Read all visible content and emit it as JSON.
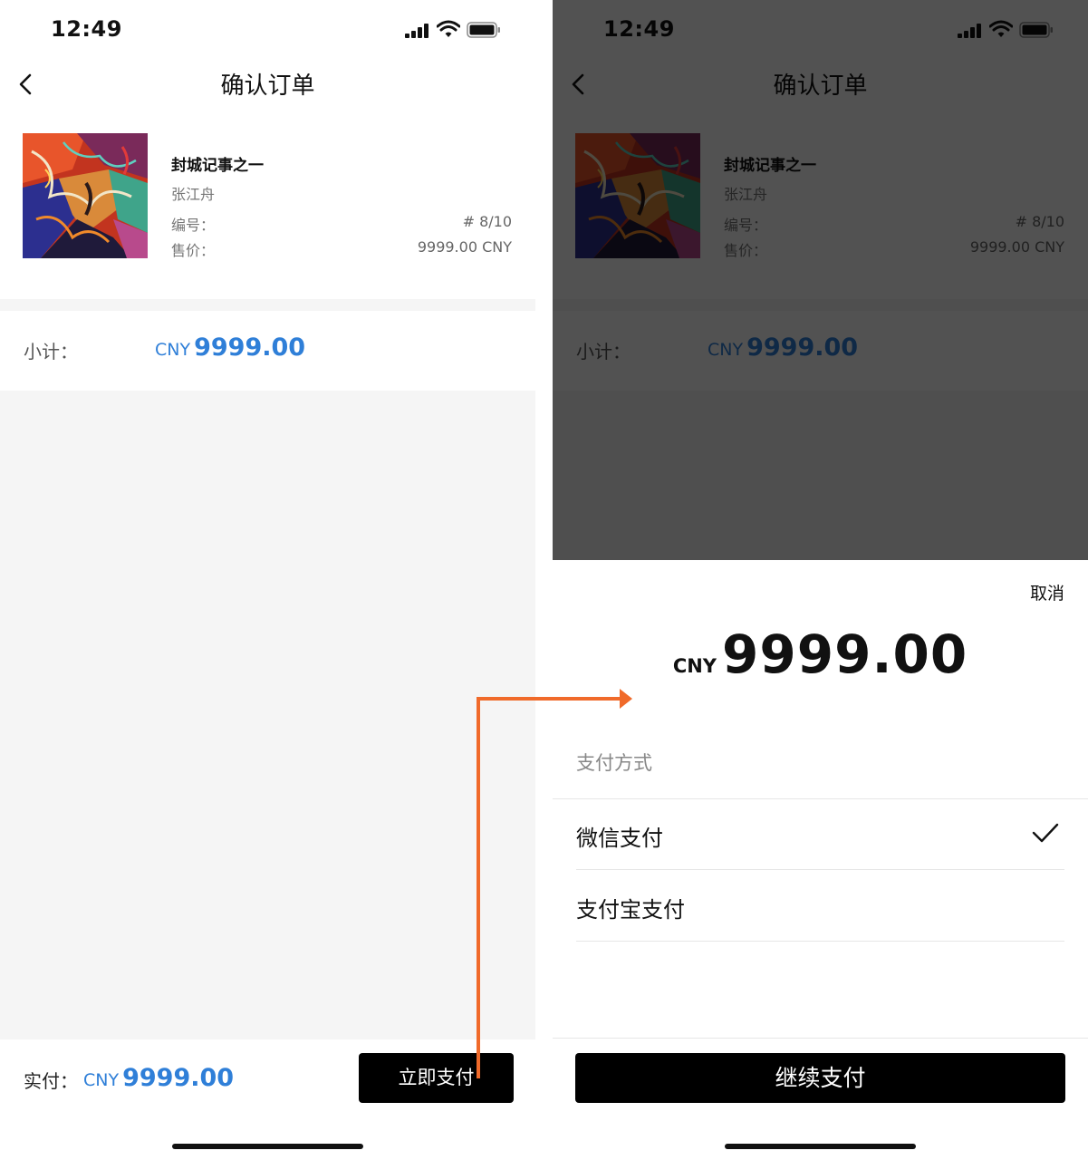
{
  "status_bar": {
    "time": "12:49"
  },
  "nav": {
    "title": "确认订单"
  },
  "product": {
    "title": "封城记事之一",
    "artist": "张江舟",
    "edition_label": "编号：",
    "edition_value": "# 8/10",
    "price_label": "售价：",
    "price_value": "9999.00 CNY"
  },
  "subtotal": {
    "label": "小计：",
    "currency": "CNY",
    "amount": "9999.00"
  },
  "footer": {
    "paid_label": "实付：",
    "currency": "CNY",
    "amount": "9999.00",
    "pay_button": "立即支付"
  },
  "sheet": {
    "cancel": "取消",
    "currency": "CNY",
    "amount": "9999.00",
    "method_heading": "支付方式",
    "methods": [
      {
        "label": "微信支付",
        "selected": true
      },
      {
        "label": "支付宝支付",
        "selected": false
      }
    ],
    "continue_button": "继续支付"
  },
  "colors": {
    "accent_blue": "#2f7fd8",
    "button_black": "#000000",
    "page_background": "#f5f5f5",
    "annotation_arrow": "#f06a2a"
  }
}
